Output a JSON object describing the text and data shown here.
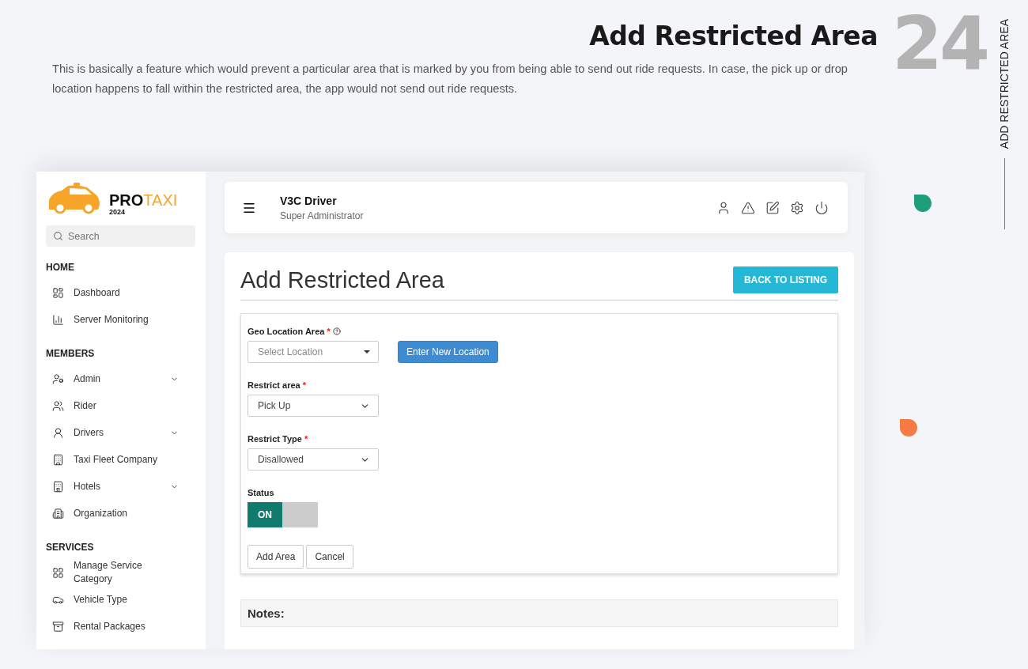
{
  "header": {
    "title": "Add Restricted Area",
    "number": "24",
    "side_label": "ADD RESTRICTED AREA",
    "description": "This is basically a feature which would prevent a particular area that is marked by you from being able to send out ride requests. In case, the pick up or drop location happens to fall within the restricted area, the app would not send out ride requests."
  },
  "brand": {
    "name_dark": "PRO",
    "name_accent": "TAXI",
    "year": "2024"
  },
  "search": {
    "placeholder": "Search"
  },
  "sidebar": {
    "sections": [
      {
        "heading": "HOME",
        "items": [
          {
            "label": "Dashboard",
            "expandable": false
          },
          {
            "label": "Server Monitoring",
            "expandable": false
          }
        ]
      },
      {
        "heading": "MEMBERS",
        "items": [
          {
            "label": "Admin",
            "expandable": true
          },
          {
            "label": "Rider",
            "expandable": false
          },
          {
            "label": "Drivers",
            "expandable": true
          },
          {
            "label": "Taxi Fleet Company",
            "expandable": false
          },
          {
            "label": "Hotels",
            "expandable": true
          },
          {
            "label": "Organization",
            "expandable": false
          }
        ]
      },
      {
        "heading": "SERVICES",
        "items": [
          {
            "label": "Manage Service Category",
            "expandable": false
          },
          {
            "label": "Vehicle Type",
            "expandable": false
          },
          {
            "label": "Rental Packages",
            "expandable": false
          }
        ]
      }
    ]
  },
  "topbar": {
    "user_name": "V3C Driver",
    "user_role": "Super Administrator"
  },
  "page": {
    "title": "Add Restricted Area",
    "back_button": "BACK TO LISTING"
  },
  "form": {
    "fields": [
      {
        "kind": "location",
        "label": "Geo Location Area",
        "required_mark": "*",
        "help": true,
        "placeholder": "Select Location",
        "button": "Enter New Location"
      },
      {
        "kind": "select",
        "label": "Restrict area",
        "required_mark": "*",
        "value": "Pick Up"
      },
      {
        "kind": "select",
        "label": "Restrict Type",
        "required_mark": "*",
        "value": "Disallowed"
      },
      {
        "kind": "toggle",
        "label": "Status",
        "on": true,
        "on_text": "ON"
      }
    ],
    "buttons": [
      "Add Area",
      "Cancel"
    ]
  },
  "notes": {
    "title": "Notes:"
  }
}
